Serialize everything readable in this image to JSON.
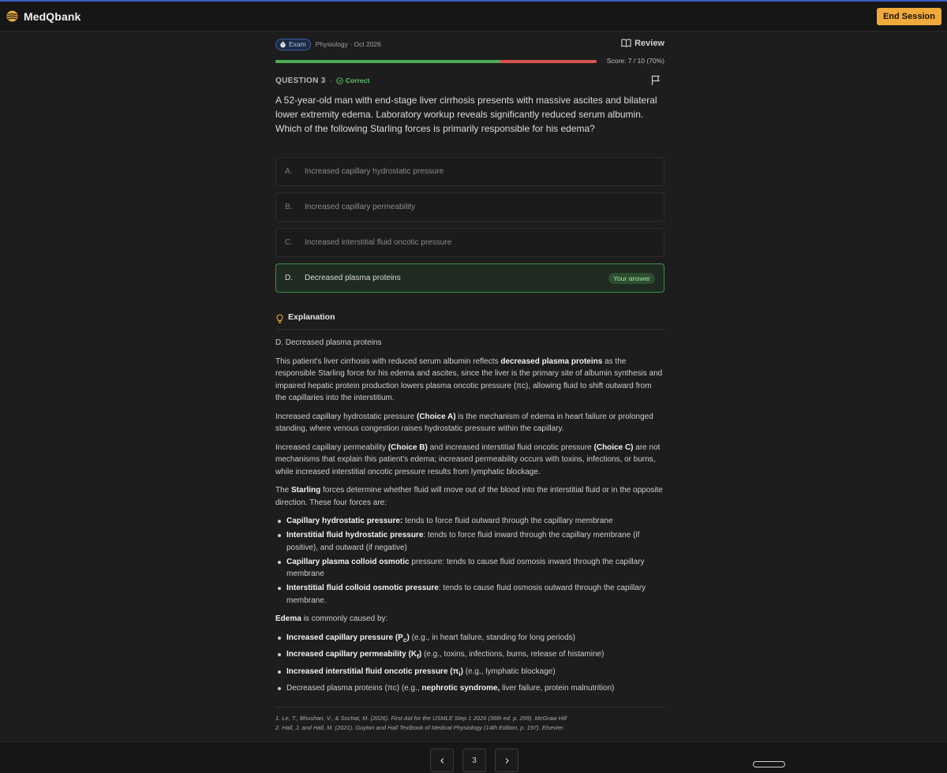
{
  "app": {
    "name": "MedQbank",
    "end_session_label": "End Session"
  },
  "session": {
    "mode_badge": "Exam",
    "meta": "Physiology · Oct 2026",
    "review_label": "Review",
    "score_text": "Score: 7 / 10 (70%)",
    "progress": {
      "correct_fraction": 0.7,
      "correct_color": "#4cae55",
      "incorrect_color": "#d9534f"
    }
  },
  "question": {
    "label": "QUESTION 3",
    "separator": "·",
    "status": "Correct",
    "stem": "A 52-year-old man with end-stage liver cirrhosis presents with massive ascites and bilateral lower extremity edema. Laboratory workup reveals significantly reduced serum albumin. Which of the following Starling forces is primarily responsible for his edema?",
    "choices": [
      {
        "letter": "A.",
        "text": "Increased capillary hydrostatic pressure",
        "selected": false
      },
      {
        "letter": "B.",
        "text": "Increased capillary permeability",
        "selected": false
      },
      {
        "letter": "C.",
        "text": "Increased interstitial fluid oncotic pressure",
        "selected": false
      },
      {
        "letter": "D.",
        "text": "Decreased plasma proteins",
        "selected": true,
        "tag": "Your answer"
      }
    ]
  },
  "explanation": {
    "title": "Explanation",
    "answer_line": "D. Decreased plasma proteins",
    "p1": {
      "a": "This patient's liver cirrhosis with reduced serum albumin reflects ",
      "b": "decreased plasma proteins",
      "c": " as the responsible Starling force for his edema and ascites, since the liver is the primary site of albumin synthesis and impaired hepatic protein production lowers plasma oncotic pressure (πc), allowing fluid to shift outward from the capillaries into the interstitium."
    },
    "p2": {
      "a": "Increased capillary hydrostatic pressure ",
      "b": "(Choice A)",
      "c": " is the mechanism of edema in heart failure or prolonged standing, where venous congestion raises hydrostatic pressure within the capillary."
    },
    "p3": {
      "a": "Increased capillary permeability ",
      "b": "(Choice B)",
      "c": " and increased interstitial fluid oncotic pressure ",
      "d": "(Choice C)",
      "e": " are not mechanisms that explain this patient's edema; increased permeability occurs with toxins, infections, or burns, while increased interstitial oncotic pressure results from lymphatic blockage."
    },
    "p4": {
      "a": "The ",
      "b": "Starling",
      "c": " forces determine whether fluid will move out of the blood into the interstitial fluid or in the opposite direction. These four forces are:"
    },
    "forces": [
      {
        "b": "Capillary hydrostatic pressure:",
        "t": " tends to force fluid outward through the capillary membrane"
      },
      {
        "b": "Interstitial fluid hydrostatic pressure",
        "t": ": tends to force fluid inward through the capillary membrane (if positive), and outward (if negative)"
      },
      {
        "b": "Capillary plasma colloid osmotic",
        "t": " pressure: tends to cause fluid osmosis inward through the capillary membrane"
      },
      {
        "b": "Interstitial fluid colloid osmotic pressure",
        "t": ": tends to cause fluid osmosis outward through the capillary membrane."
      }
    ],
    "edema_intro": {
      "b": "Edema",
      "t": " is commonly caused by:"
    },
    "causes": [
      {
        "b": "Increased capillary pressure (P",
        "sub": "c",
        "b2": ")",
        "t": " (e.g., in heart failure, standing for long periods)"
      },
      {
        "b": "Increased capillary permeability (K",
        "sub": "f",
        "b2": ")",
        "t": " (e.g., toxins, infections, burns, release of histamine)"
      },
      {
        "b": "Increased interstitial fluid oncotic pressure (π",
        "sub": "i",
        "b2": ")",
        "t": " (e.g., lymphatic blockage)"
      }
    ],
    "cause4": {
      "a": "Decreased plasma proteins (πc) (e.g., ",
      "b": "nephrotic syndrome,",
      "c": " liver failure, protein malnutrition)"
    }
  },
  "references": [
    "1. Le, T., Bhushan, V., & Sochat, M. (2026). First Aid for the USMLE Step 1 2026 (36th ed. p. 299). McGraw Hill",
    "2. Hall, J, and Hall, M. (2021). Guyton and Hall Textbook of Medical Physiology (14th Edition, p. 197). Elsevier."
  ],
  "pager": {
    "current_page": "3"
  },
  "icons": [
    "logo-icon",
    "timer-icon",
    "book-icon",
    "check-circle-icon",
    "flag-icon",
    "lightbulb-icon",
    "chevron-left-icon",
    "chevron-right-icon"
  ]
}
